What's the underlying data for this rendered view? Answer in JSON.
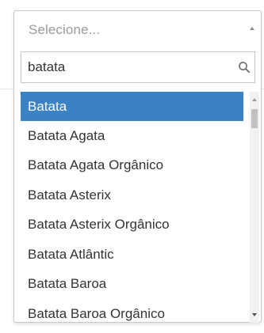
{
  "select": {
    "placeholder": "Selecione..."
  },
  "search": {
    "value": "batata",
    "icon": "search-icon"
  },
  "results": [
    {
      "label": "Batata",
      "selected": true
    },
    {
      "label": "Batata Agata",
      "selected": false
    },
    {
      "label": "Batata Agata Orgânico",
      "selected": false
    },
    {
      "label": "Batata Asterix",
      "selected": false
    },
    {
      "label": "Batata Asterix Orgânico",
      "selected": false
    },
    {
      "label": "Batata Atlântic",
      "selected": false
    },
    {
      "label": "Batata Baroa",
      "selected": false
    },
    {
      "label": "Batata Baroa Orgânico",
      "selected": false
    }
  ],
  "colors": {
    "highlight": "#3a82c3",
    "text": "#333333",
    "placeholder": "#9a9a9a",
    "border": "#c9c9c9"
  }
}
